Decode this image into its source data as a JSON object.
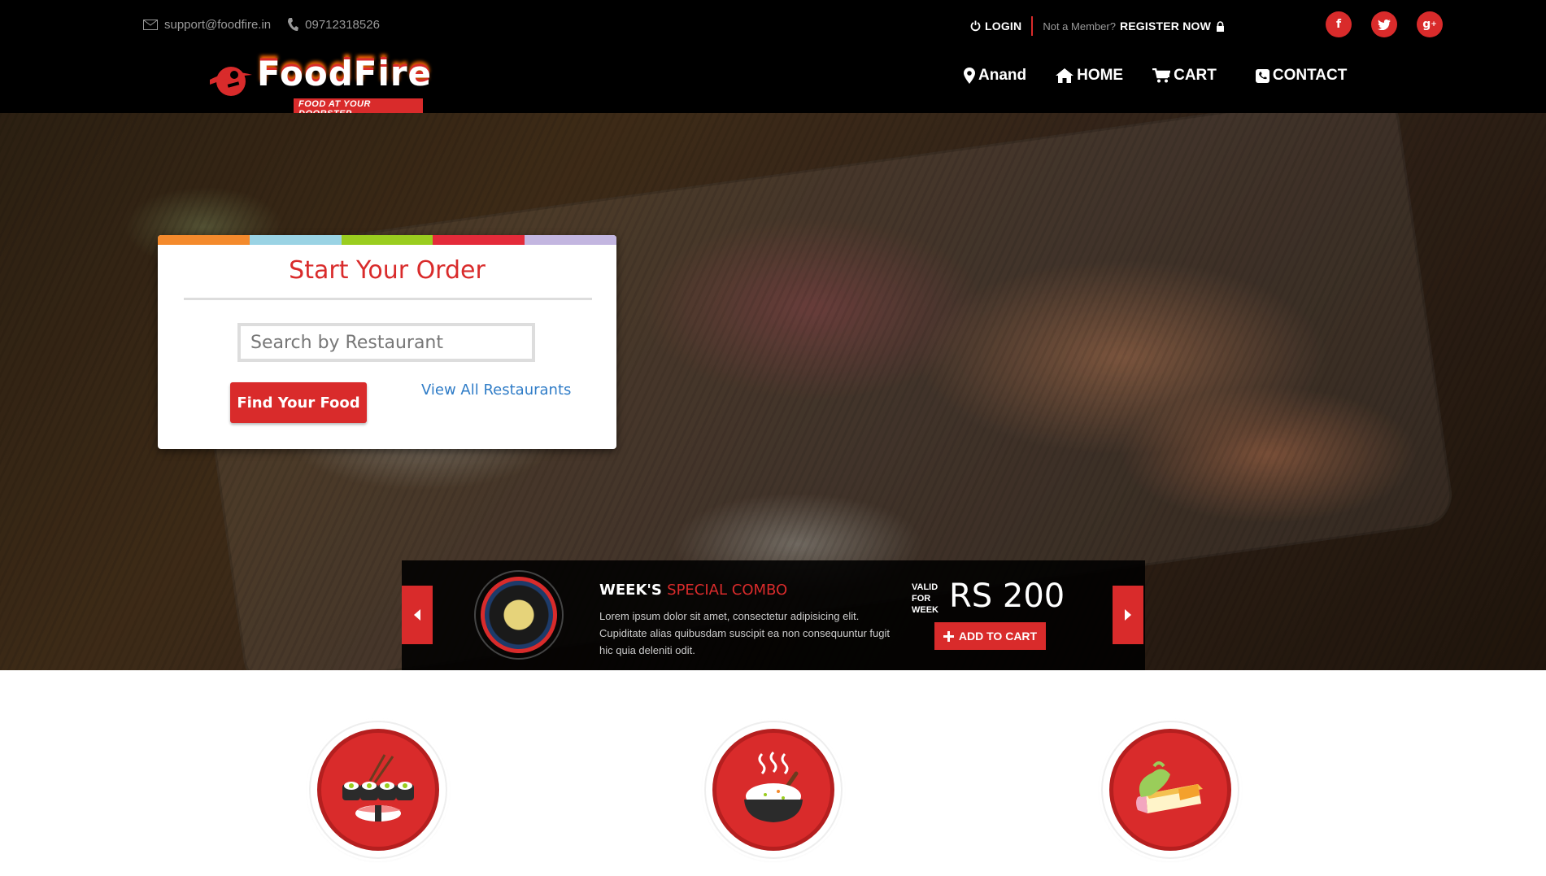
{
  "topbar": {
    "email": "support@foodfire.in",
    "phone": "09712318526",
    "login_label": "LOGIN",
    "not_member_label": "Not a Member?",
    "register_label": "REGISTER NOW"
  },
  "social": [
    "facebook-icon",
    "twitter-icon",
    "google-plus-icon"
  ],
  "logo": {
    "name": "FoodFire",
    "tagline": "FOOD AT YOUR DOORSTEP"
  },
  "nav": {
    "location": "Anand",
    "home": "HOME",
    "cart": "CART",
    "contact": "CONTACT"
  },
  "order": {
    "title": "Start Your Order",
    "search_placeholder": "Search by Restaurant",
    "find_button": "Find Your Food",
    "view_all": "View All Restaurants",
    "stripe_colors": [
      "#f48a2c",
      "#9ad3e4",
      "#9acd1f",
      "#e42b3a",
      "#c3b6e0"
    ]
  },
  "combo": {
    "title_prefix": "WEEK'S",
    "title_highlight": "SPECIAL COMBO",
    "description": "Lorem ipsum dolor sit amet, consectetur adipisicing elit. Cupiditate alias quibusdam suscipit ea non consequuntur fugit hic quia deleniti odit.",
    "valid_line1": "VALID",
    "valid_line2": "FOR",
    "valid_line3": "WEEK",
    "price": "RS 200",
    "add_to_cart": "ADD TO CART"
  },
  "categories": [
    "sushi-icon",
    "rice-bowl-icon",
    "cake-slice-icon"
  ],
  "colors": {
    "accent": "#d92b2b",
    "link": "#2f7cc7",
    "header_bg": "#000000"
  }
}
